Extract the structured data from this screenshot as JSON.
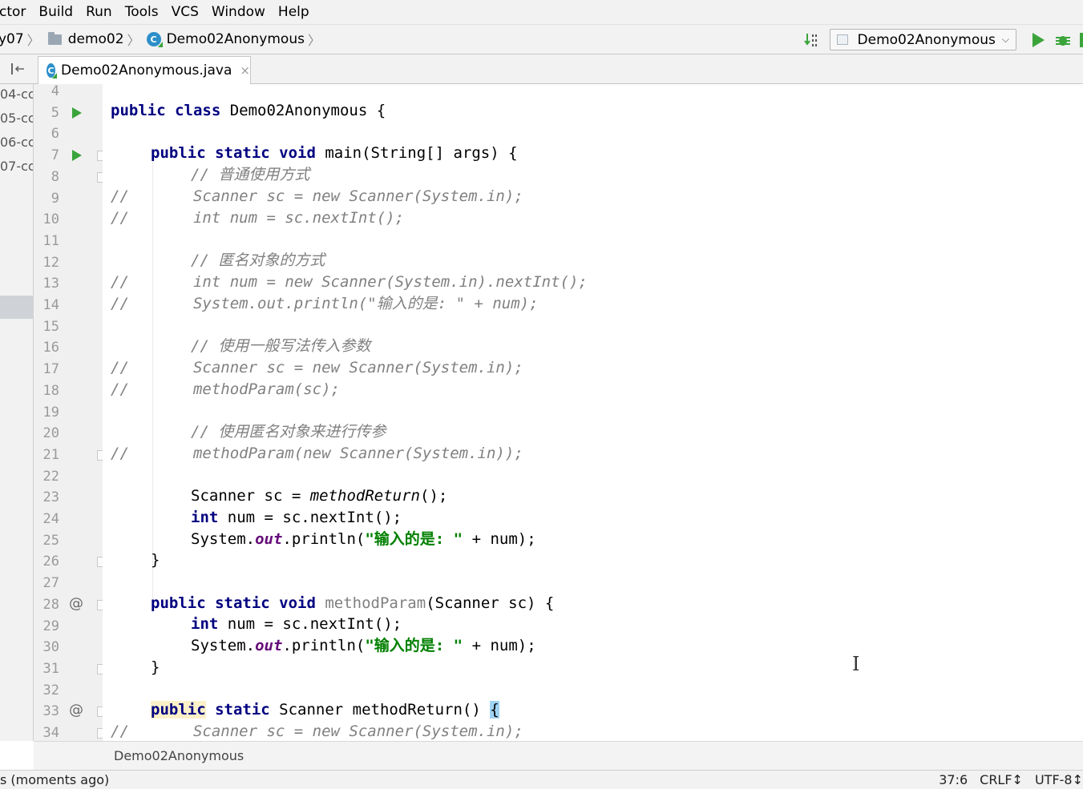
{
  "menu": [
    "ctor",
    "Build",
    "Run",
    "Tools",
    "VCS",
    "Window",
    "Help"
  ],
  "nav": {
    "crumbs": [
      "y07",
      "demo02",
      "Demo02Anonymous"
    ],
    "run_config": "Demo02Anonymous"
  },
  "tab": {
    "filename": "Demo02Anonymous.java",
    "close": "×"
  },
  "left_strip": [
    "04-cc",
    "05-cc",
    "06-cc",
    "07-cc"
  ],
  "gutter": {
    "line_numbers": [
      "4",
      "5",
      "6",
      "7",
      "8",
      "9",
      "10",
      "11",
      "12",
      "13",
      "14",
      "15",
      "16",
      "17",
      "18",
      "19",
      "20",
      "21",
      "22",
      "23",
      "24",
      "25",
      "26",
      "27",
      "28",
      "29",
      "30",
      "31",
      "32",
      "33",
      "34"
    ],
    "run_mark_lines": [
      "5",
      "7"
    ],
    "override_mark_lines": [
      "28",
      "33"
    ],
    "at_symbol": "@"
  },
  "code": {
    "l5": {
      "kw": "public class",
      "rest": " Demo02Anonymous {"
    },
    "l7": {
      "kw": "public static void",
      "rest": " main(String[] args) {"
    },
    "l8": "// 普通使用方式",
    "l9": "//       Scanner sc = new Scanner(System.in);",
    "l10": "//       int num = sc.nextInt();",
    "l12": "// 匿名对象的方式",
    "l13": "//       int num = new Scanner(System.in).nextInt();",
    "l14": "//       System.out.println(\"输入的是: \" + num);",
    "l16": "// 使用一般写法传入参数",
    "l17": "//       Scanner sc = new Scanner(System.in);",
    "l18": "//       methodParam(sc);",
    "l20": "// 使用匿名对象来进行传参",
    "l21": "//       methodParam(new Scanner(System.in));",
    "l23": {
      "a": "Scanner sc = ",
      "b": "methodReturn",
      "c": "();"
    },
    "l24": {
      "kw": "int",
      "rest": " num = sc.nextInt();"
    },
    "l25": {
      "a": "System.",
      "fld": "out",
      "b": ".println(",
      "str": "\"输入的是: \"",
      "c": " + num);"
    },
    "l26": "}",
    "l28": {
      "kw": "public static void",
      "name": " methodParam",
      "rest": "(Scanner sc) {"
    },
    "l29": {
      "kw": "int",
      "rest": " num = sc.nextInt();"
    },
    "l30": {
      "a": "System.",
      "fld": "out",
      "b": ".println(",
      "str": "\"输入的是: \"",
      "c": " + num);"
    },
    "l31": "}",
    "l33": {
      "kw1": "public",
      "kw2": " static",
      "rest": " Scanner methodReturn() ",
      "brace": "{"
    },
    "l34": "//       Scanner sc = new Scanner(System.in);"
  },
  "editor_breadcrumb": "Demo02Anonymous",
  "status": {
    "left": "s (moments ago)",
    "position": "37:6",
    "line_sep": "CRLF↕",
    "encoding": "UTF-8↕"
  }
}
